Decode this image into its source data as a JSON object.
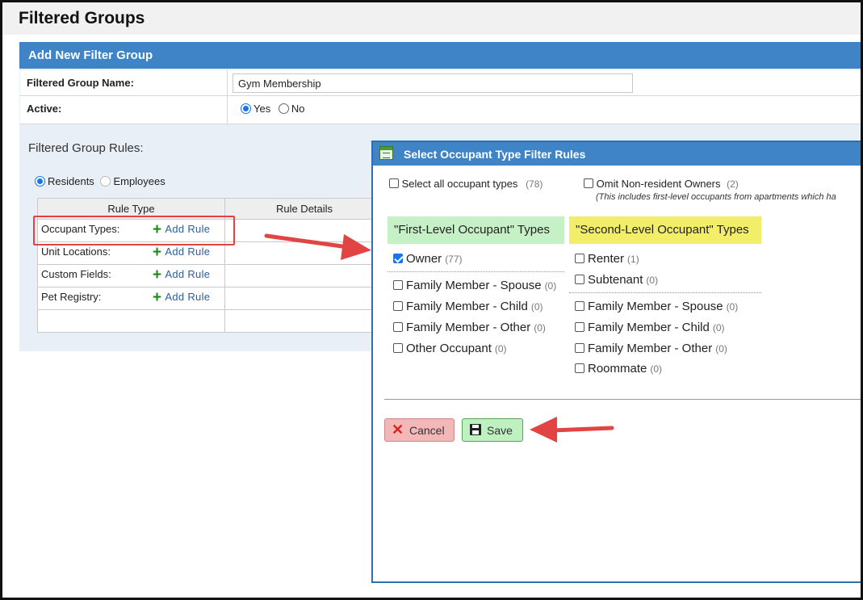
{
  "page": {
    "title": "Filtered Groups"
  },
  "panel": {
    "header": "Add New Filter Group",
    "name_label": "Filtered Group Name:",
    "name_value": "Gym Membership",
    "active_label": "Active:",
    "active_yes": "Yes",
    "active_no": "No",
    "active_selected": "Yes",
    "rules_title": "Filtered Group Rules:",
    "who_residents": "Residents",
    "who_employees": "Employees",
    "who_selected": "Residents"
  },
  "rules_table": {
    "headers": [
      "Rule Type",
      "Rule Details"
    ],
    "add_label": "Add Rule",
    "rows": [
      "Occupant Types:",
      "Unit Locations:",
      "Custom Fields:",
      "Pet Registry:"
    ]
  },
  "dialog": {
    "title": "Select Occupant Type Filter Rules",
    "select_all": {
      "label": "Select all occupant types",
      "count": "(78)",
      "checked": false
    },
    "omit": {
      "label": "Omit Non-resident Owners",
      "count": "(2)",
      "checked": false,
      "note": "(This includes first-level occupants from apartments which ha"
    },
    "first_level": {
      "header": "\"First-Level Occupant\" Types",
      "items": [
        {
          "label": "Owner",
          "count": "(77)",
          "checked": true
        },
        {
          "label": "Family Member - Spouse",
          "count": "(0)",
          "checked": false
        },
        {
          "label": "Family Member - Child",
          "count": "(0)",
          "checked": false
        },
        {
          "label": "Family Member - Other",
          "count": "(0)",
          "checked": false
        },
        {
          "label": "Other Occupant",
          "count": "(0)",
          "checked": false
        }
      ]
    },
    "second_level": {
      "header": "\"Second-Level Occupant\" Types",
      "items": [
        {
          "label": "Renter",
          "count": "(1)",
          "checked": false
        },
        {
          "label": "Subtenant",
          "count": "(0)",
          "checked": false
        },
        {
          "label": "Family Member - Spouse",
          "count": "(0)",
          "checked": false
        },
        {
          "label": "Family Member - Child",
          "count": "(0)",
          "checked": false
        },
        {
          "label": "Family Member - Other",
          "count": "(0)",
          "checked": false
        },
        {
          "label": "Roommate",
          "count": "(0)",
          "checked": false
        }
      ]
    },
    "cancel_label": "Cancel",
    "save_label": "Save"
  },
  "colors": {
    "header_blue": "#3e84c6",
    "first_level_bg": "#c6f0c6",
    "second_level_bg": "#f2ee6a",
    "annotation_red": "#e24444"
  }
}
